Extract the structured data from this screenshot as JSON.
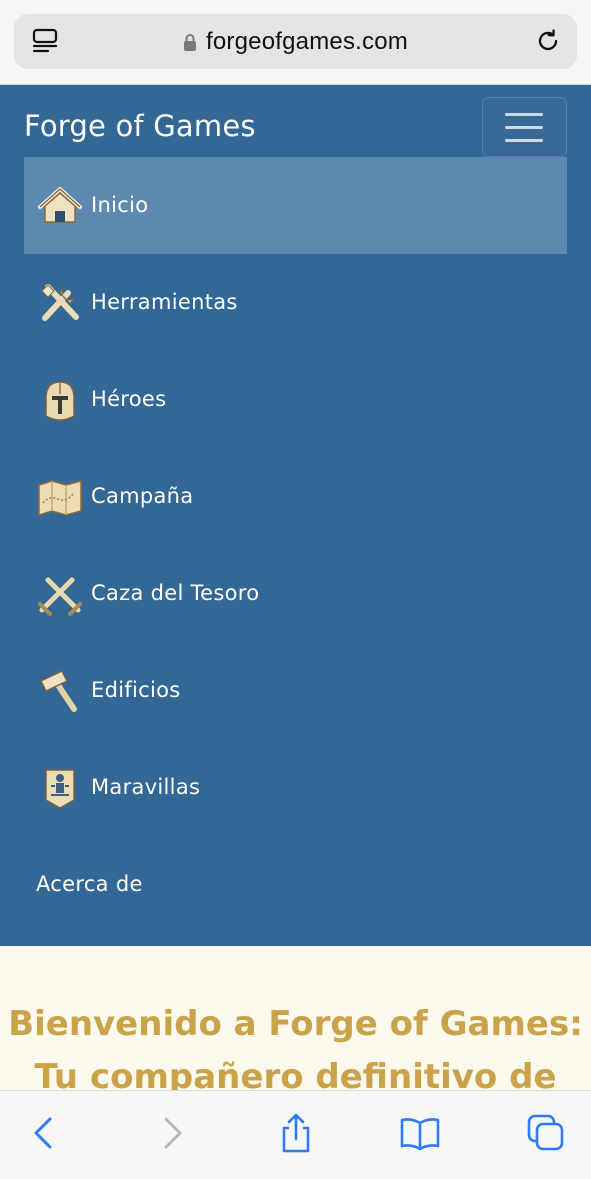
{
  "browser": {
    "url": "forgeofgames.com",
    "icons": {
      "reader": "reader-mode-icon",
      "lock": "lock-icon",
      "reload": "reload-icon"
    }
  },
  "navbar": {
    "brand": "Forge of Games",
    "toggler_icon": "hamburger-menu-icon",
    "items": [
      {
        "label": "Inicio",
        "icon": "home-icon",
        "active": true
      },
      {
        "label": "Herramientas",
        "icon": "tools-icon",
        "active": false
      },
      {
        "label": "Héroes",
        "icon": "helmet-icon",
        "active": false
      },
      {
        "label": "Campaña",
        "icon": "map-icon",
        "active": false
      },
      {
        "label": "Caza del Tesoro",
        "icon": "crossed-swords-icon",
        "active": false
      },
      {
        "label": "Edificios",
        "icon": "hammer-icon",
        "active": false
      },
      {
        "label": "Maravillas",
        "icon": "wonder-icon",
        "active": false
      },
      {
        "label": "Acerca de",
        "icon": "",
        "active": false
      }
    ]
  },
  "content": {
    "heading_line1": "Bienvenido a Forge of Games:",
    "heading_line2": "Tu compañero definitivo de"
  },
  "toolbar": {
    "icons": [
      "back-icon",
      "forward-icon",
      "share-icon",
      "bookmarks-icon",
      "tabs-icon"
    ]
  },
  "colors": {
    "navbar_bg": "#336795",
    "active_item_bg": "#5d89b0",
    "page_bg": "#fdf9ec",
    "heading": "#c9a24a",
    "ios_blue": "#2f7bf5"
  }
}
